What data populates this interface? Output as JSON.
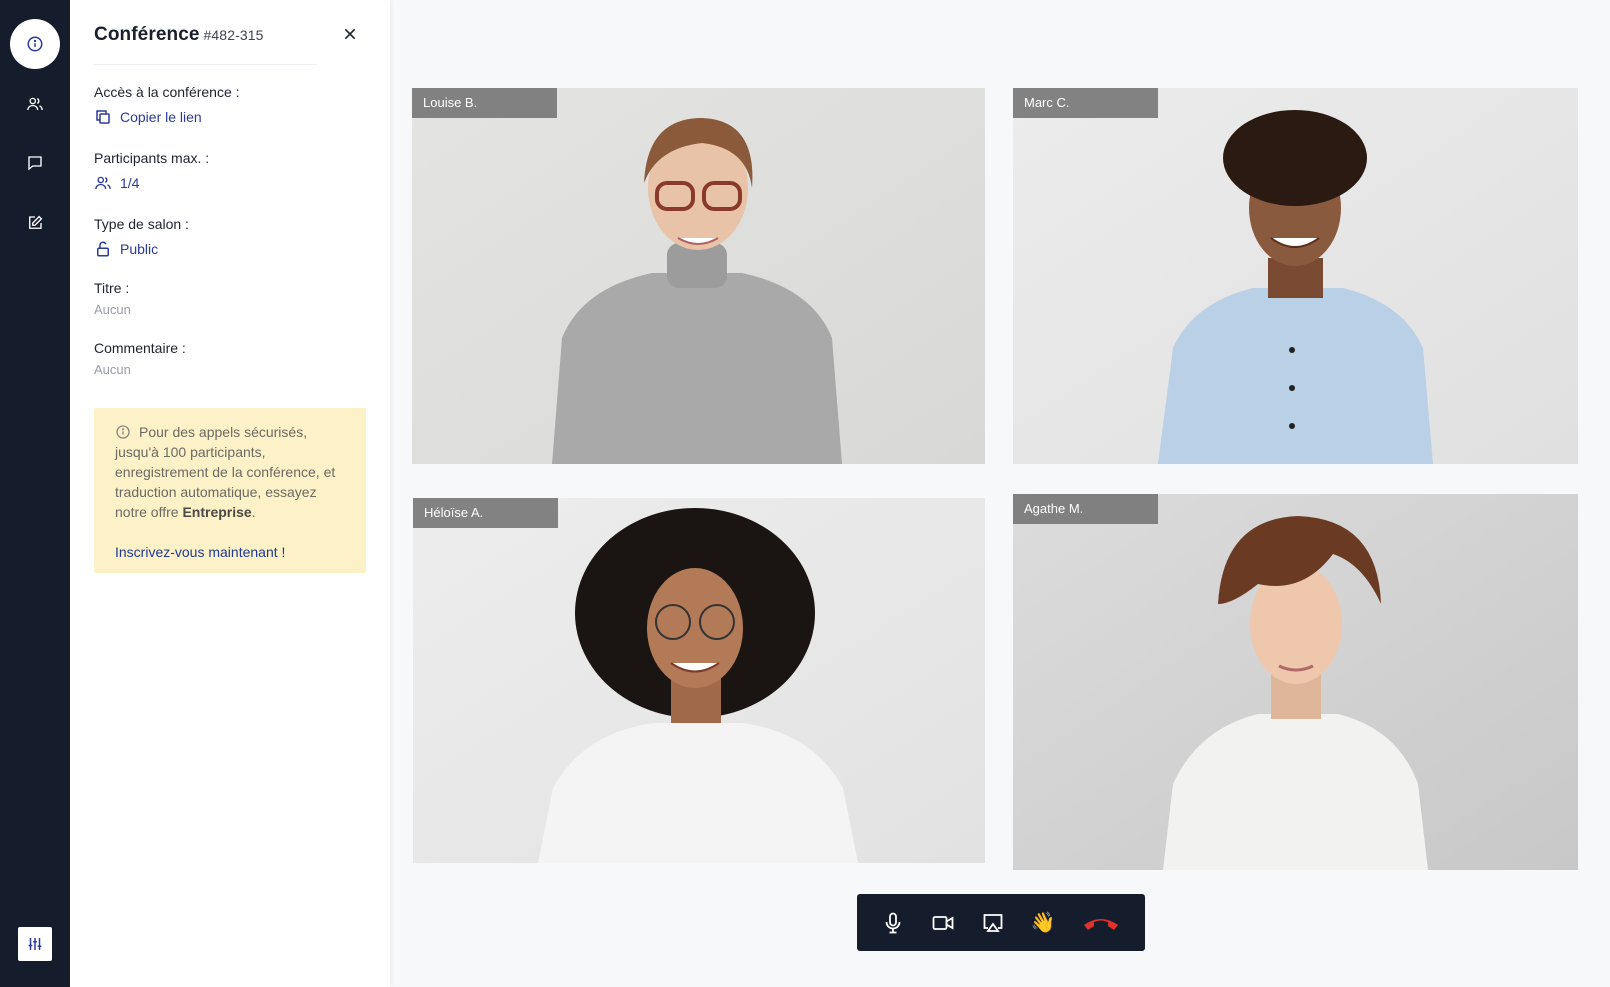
{
  "rail": {
    "items": [
      {
        "icon": "info-icon",
        "active": true
      },
      {
        "icon": "people-icon",
        "active": false
      },
      {
        "icon": "chat-icon",
        "active": false
      },
      {
        "icon": "edit-icon",
        "active": false
      }
    ],
    "bottom_icon": "settings-sliders-icon"
  },
  "panel": {
    "title": "Conférence",
    "id": "#482-315",
    "access_label": "Accès à la conférence :",
    "access_value": "Copier le lien",
    "max_label": "Participants max. :",
    "max_value": "1/4",
    "type_label": "Type de salon :",
    "type_value": "Public",
    "title_label": "Titre :",
    "title_value": "Aucun",
    "comment_label": "Commentaire :",
    "comment_value": "Aucun",
    "promo_text_1": "Pour des appels sécurisés, jusqu'à 100 participants, enregistrement de la conférence, et traduction automatique, essayez notre offre ",
    "promo_strong": "Entreprise",
    "promo_text_2": ".",
    "promo_link": "Inscrivez-vous maintenant !"
  },
  "participants": [
    {
      "name": "Louise B."
    },
    {
      "name": "Marc C."
    },
    {
      "name": "Héloïse A."
    },
    {
      "name": "Agathe M."
    }
  ],
  "controls": {
    "raise_hand": "👋",
    "items": [
      "microphone-icon",
      "camera-icon",
      "screen-share-icon",
      "raise-hand-icon",
      "hang-up-icon"
    ]
  },
  "colors": {
    "sidebar_bg": "#151c2c",
    "link": "#2a3a9a",
    "promo_bg": "#fdf1c8",
    "hangup": "#e0322b"
  }
}
